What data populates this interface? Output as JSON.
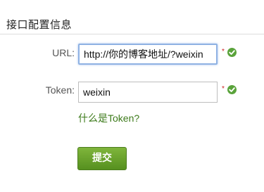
{
  "section": {
    "title": "接口配置信息"
  },
  "form": {
    "url_label": "URL:",
    "url_value": "http://你的博客地址/?weixin",
    "token_label": "Token:",
    "token_value": "weixin",
    "required_marker": "*",
    "help_link_text": "什么是Token?",
    "submit_label": "提交"
  },
  "icons": {
    "validation": "check-circle-icon"
  },
  "colors": {
    "accent_green": "#5aa33b",
    "link_green": "#3c7a1a",
    "button_top": "#7fb53b",
    "button_bottom": "#56901f",
    "focus_border": "#8fb2e3"
  }
}
